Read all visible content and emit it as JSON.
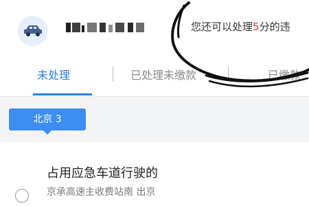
{
  "header": {
    "car_icon": "car-icon",
    "notice_prefix": "您还可以处理",
    "notice_count": "5",
    "notice_suffix": "分的违"
  },
  "tabs": [
    {
      "label": "未处理",
      "active": true
    },
    {
      "label": "已处理未缴款",
      "active": false
    },
    {
      "label": "已缴款",
      "active": false
    }
  ],
  "city_tag": {
    "label": "北京 3"
  },
  "violation": {
    "title": "占用应急车道行驶的",
    "location": "京承高速主收费站南 出京"
  },
  "colors": {
    "accent": "#2a7de1",
    "tag": "#3d8ef0",
    "highlight": "#e23b3b"
  }
}
